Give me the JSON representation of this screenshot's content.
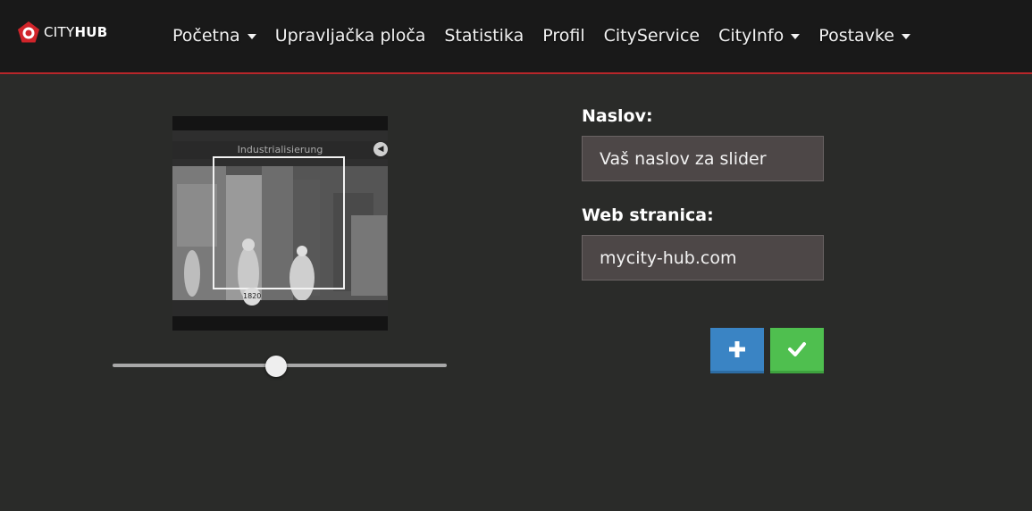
{
  "brand": {
    "name_light": "CITY",
    "name_bold": "HUB",
    "accent_color": "#b8262a",
    "icon": "pentagon-logo-icon"
  },
  "nav": {
    "items": [
      {
        "label": "Početna",
        "has_dropdown": true
      },
      {
        "label": "Upravljačka ploča",
        "has_dropdown": false
      },
      {
        "label": "Statistika",
        "has_dropdown": false
      },
      {
        "label": "Profil",
        "has_dropdown": false
      },
      {
        "label": "CityService",
        "has_dropdown": false
      },
      {
        "label": "CityInfo",
        "has_dropdown": true
      },
      {
        "label": "Postavke",
        "has_dropdown": true
      }
    ]
  },
  "preview": {
    "image_title": "Industrialisierung",
    "year_badge": "1820",
    "sound_icon": "speaker-icon"
  },
  "slider": {
    "value_fraction": 0.49
  },
  "form": {
    "title_label": "Naslov:",
    "title_placeholder": "Vaš naslov za slider",
    "website_label": "Web stranica:",
    "website_placeholder": "mycity-hub.com"
  },
  "actions": {
    "add_icon": "plus-icon",
    "add_color": "#3a84c4",
    "confirm_icon": "checkmark-icon",
    "confirm_color": "#4fbf4f"
  }
}
